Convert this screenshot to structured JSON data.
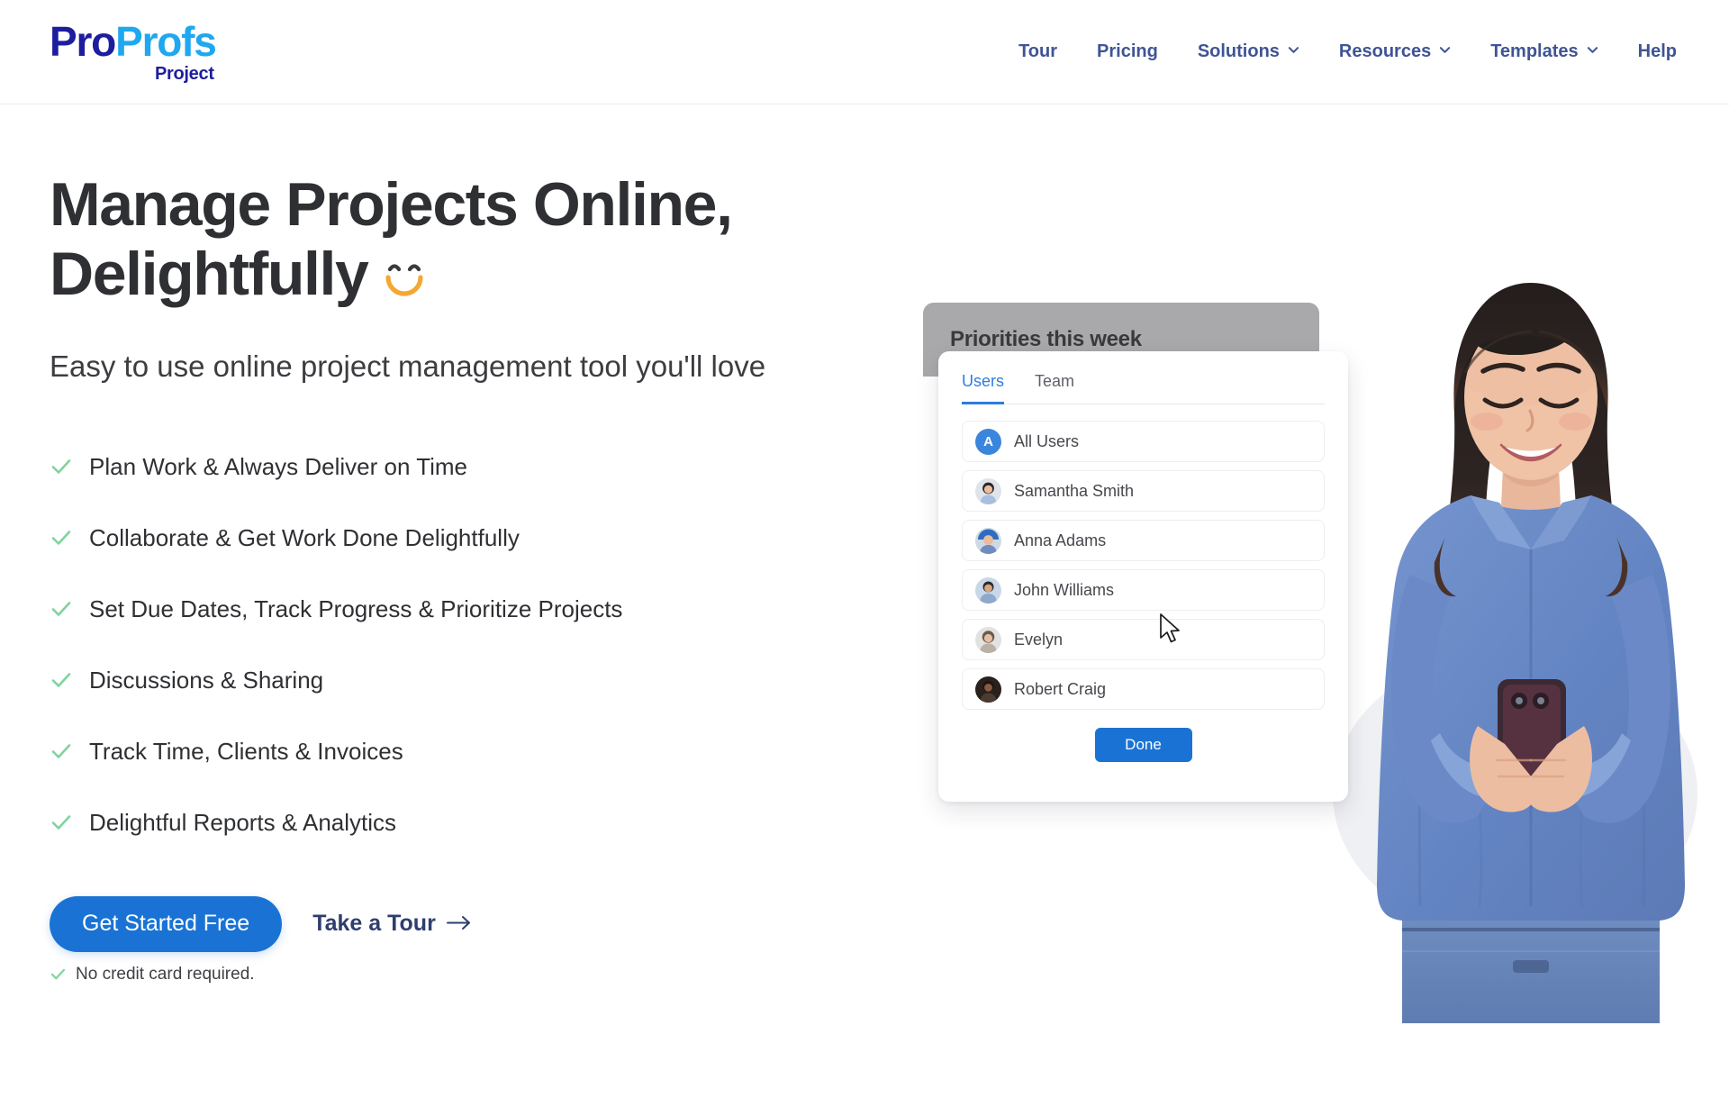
{
  "brand": {
    "part1": "Pro",
    "part2": "Profs",
    "product": "Project",
    "color_part1": "#1d1d9e",
    "color_part2": "#1fa8f0"
  },
  "nav": {
    "items": [
      {
        "label": "Tour",
        "has_dropdown": false
      },
      {
        "label": "Pricing",
        "has_dropdown": false
      },
      {
        "label": "Solutions",
        "has_dropdown": true
      },
      {
        "label": "Resources",
        "has_dropdown": true
      },
      {
        "label": "Templates",
        "has_dropdown": true
      },
      {
        "label": "Help",
        "has_dropdown": false
      }
    ],
    "color": "#3f5494"
  },
  "hero": {
    "headline_line1": "Manage Projects Online,",
    "headline_line2": "Delightfully",
    "headline_emoji": "smiling-face",
    "subhead": "Easy to use online project management tool you'll love",
    "features": [
      "Plan Work & Always Deliver on Time",
      "Collaborate & Get Work Done Delightfully",
      "Set Due Dates, Track Progress & Prioritize Projects",
      "Discussions & Sharing",
      "Track Time, Clients & Invoices",
      "Delightful Reports & Analytics"
    ],
    "check_color": "#7fd39b",
    "primary_cta": "Get Started Free",
    "secondary_cta": "Take a Tour",
    "no_credit_card": "No credit card required.",
    "primary_color": "#1a73d4"
  },
  "mock": {
    "header_title": "Priorities this week",
    "header_bg": "#a9a9ac",
    "tabs": [
      {
        "label": "Users",
        "active": true
      },
      {
        "label": "Team",
        "active": false
      }
    ],
    "active_tab_color": "#2b7de0",
    "users": [
      {
        "name": "All Users",
        "avatar_type": "initial",
        "initial": "A",
        "avatar_color": "#3b86dd"
      },
      {
        "name": "Samantha Smith",
        "avatar_type": "photo"
      },
      {
        "name": "Anna Adams",
        "avatar_type": "photo"
      },
      {
        "name": "John Williams",
        "avatar_type": "photo"
      },
      {
        "name": "Evelyn",
        "avatar_type": "photo"
      },
      {
        "name": "Robert Craig",
        "avatar_type": "photo"
      }
    ],
    "done_label": "Done"
  },
  "illustration": {
    "subject": "woman-smiling-holding-phone",
    "blob_color": "#eff0f3",
    "shirt_color": "#6b8ec9"
  },
  "cursor": {
    "icon": "mouse-pointer"
  }
}
